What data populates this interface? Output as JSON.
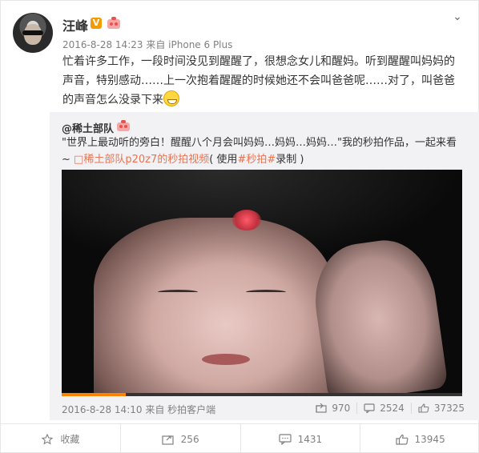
{
  "post": {
    "username": "汪峰",
    "verified_badge": "V",
    "timestamp": "2016-8-28 14:23",
    "source_prefix": "来自",
    "source": "iPhone 6 Plus",
    "text": "忙着许多工作，一段时间没见到醒醒了，很想念女儿和醒妈。听到醒醒叫妈妈的声音，特别感动……上一次抱着醒醒的时候她还不会叫爸爸呢……对了，叫爸爸的声音怎么没录下来"
  },
  "repost": {
    "username": "@稀土部队",
    "text_main": "\"世界上最动听的旁白！醒醒八个月会叫妈妈…妈妈…妈妈…\"我的秒拍作品，一起来看~ ",
    "link_text": "稀土部队p20z7的秒拍视频",
    "text_suffix_pre": "( 使用",
    "hashtag": "#秒拍#",
    "text_suffix_post": "录制 )",
    "timestamp": "2016-8-28 14:10",
    "source_prefix": "来自",
    "source": "秒拍客户端",
    "forward_count": "970",
    "comment_count": "2524",
    "like_count": "37325",
    "video_progress": 0.16
  },
  "actions": {
    "favorite_label": "收藏",
    "forward_count": "256",
    "comment_count": "1431",
    "like_count": "13945"
  },
  "icons": {
    "menu": "chevron-down-icon",
    "favorite": "star-icon",
    "forward": "forward-icon",
    "comment": "comment-icon",
    "like": "thumb-up-icon"
  },
  "colors": {
    "link": "#eb7350",
    "verified": "#f39b00",
    "progress": "#ff8200"
  }
}
